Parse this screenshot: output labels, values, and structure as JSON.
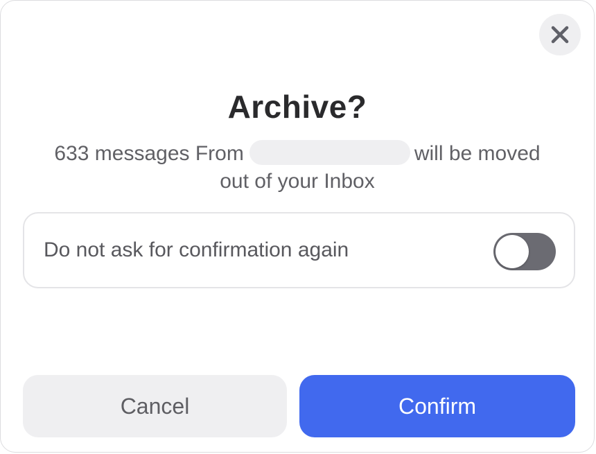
{
  "dialog": {
    "title": "Archive?",
    "message_part1": "633 messages From",
    "message_part2": "will be moved",
    "message_line2": "out of your Inbox",
    "sender_redacted": true,
    "close_icon": "close-icon"
  },
  "option": {
    "label": "Do not ask for confirmation again",
    "toggle_on": false
  },
  "buttons": {
    "cancel_label": "Cancel",
    "confirm_label": "Confirm"
  },
  "colors": {
    "accent": "#4169ee",
    "toggle_off": "#6b6b72",
    "secondary_button": "#efeff1"
  }
}
